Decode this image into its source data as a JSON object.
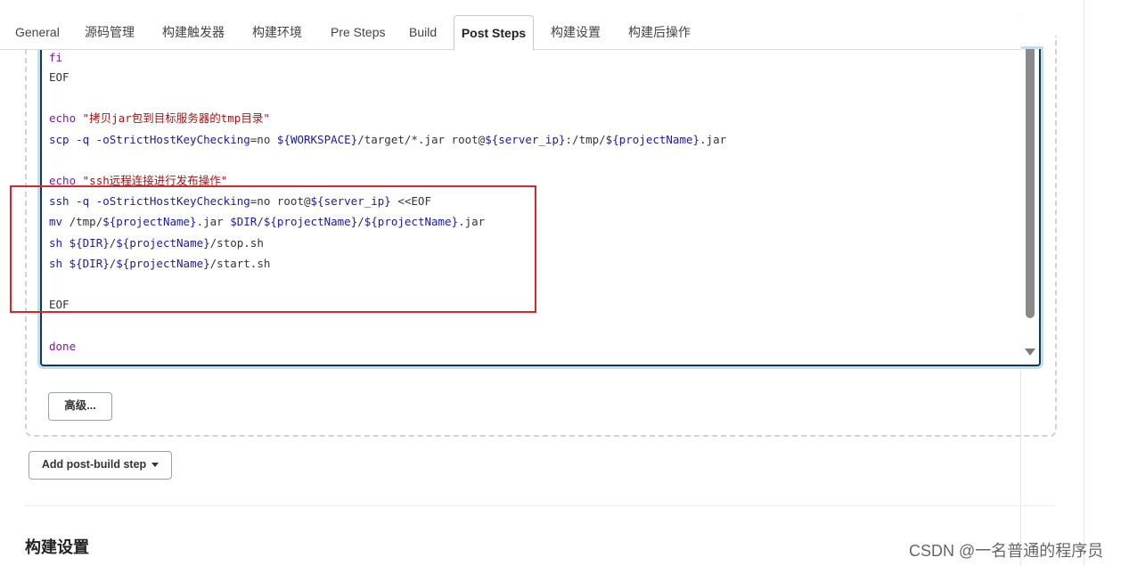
{
  "tabs": [
    {
      "label": "General",
      "active": false
    },
    {
      "label": "源码管理",
      "active": false
    },
    {
      "label": "构建触发器",
      "active": false
    },
    {
      "label": "构建环境",
      "active": false
    },
    {
      "label": "Pre Steps",
      "active": false
    },
    {
      "label": "Build",
      "active": false
    },
    {
      "label": "Post Steps",
      "active": true
    },
    {
      "label": "构建设置",
      "active": false
    },
    {
      "label": "构建后操作",
      "active": false
    }
  ],
  "editor": {
    "lines": {
      "l1": "fi",
      "l2": "EOF",
      "l4_cmd": "echo",
      "l4_str": "\"拷贝jar包到目标服务器的tmp目录\"",
      "l5_a": "scp -q -oStrictHostKeyChecking",
      "l5_b": "=no ",
      "l5_c": "${WORKSPACE}",
      "l5_d": "/target/*.jar root@",
      "l5_e": "${server_ip}",
      "l5_f": ":/tmp/",
      "l5_g": "${projectName}",
      "l5_h": ".jar",
      "l7_cmd": "echo",
      "l7_str": "\"ssh远程连接进行发布操作\"",
      "l8_a": "ssh -q -oStrictHostKeyChecking",
      "l8_b": "=no root@",
      "l8_c": "${server_ip}",
      "l8_d": " <<EOF",
      "l9_a": "mv",
      "l9_b": " /tmp/",
      "l9_c": "${projectName}",
      "l9_d": ".jar ",
      "l9_e": "$DIR",
      "l9_f": "/",
      "l9_g": "${projectName}",
      "l9_h": "/",
      "l9_i": "${projectName}",
      "l9_j": ".jar",
      "l10_a": "sh",
      "l10_b": " ${DIR}",
      "l10_c": "/",
      "l10_d": "${projectName}",
      "l10_e": "/stop.sh",
      "l11_a": "sh",
      "l11_b": " ${DIR}",
      "l11_c": "/",
      "l11_d": "${projectName}",
      "l11_e": "/start.sh",
      "l13": "EOF",
      "l15": "done"
    }
  },
  "buttons": {
    "advanced": "高级...",
    "add_post_build_step": "Add post-build step"
  },
  "section_title": "构建设置",
  "watermark": "CSDN @一名普通的程序员",
  "colors": {
    "keyword": "#7a1d9a",
    "string": "#a31515",
    "variable": "#1a1aa6",
    "highlight_box": "#d9262b",
    "editor_border": "#0f3a4f"
  }
}
